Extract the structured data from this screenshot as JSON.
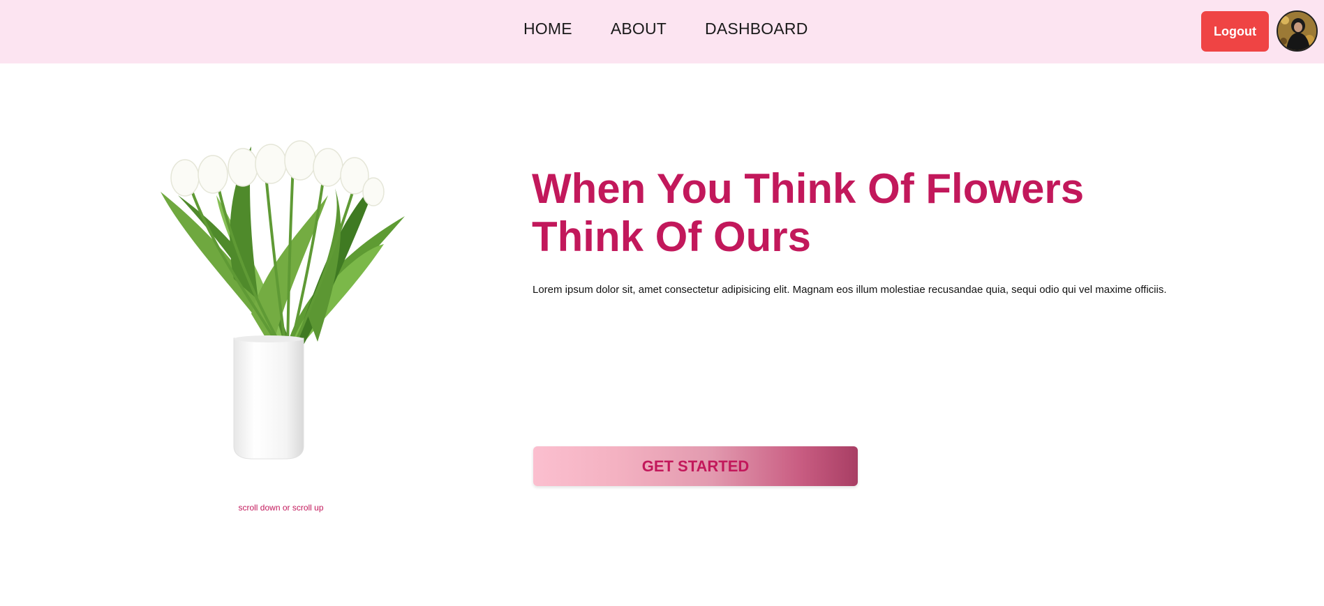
{
  "nav": {
    "links": [
      "HOME",
      "ABOUT",
      "DASHBOARD"
    ],
    "logout_label": "Logout"
  },
  "hero": {
    "title_line1": "When You Think Of Flowers",
    "title_line2": "Think Of Ours",
    "description": "Lorem ipsum dolor sit, amet consectetur adipisicing elit. Magnam eos illum molestiae recusandae quia, sequi odio qui vel maxime officiis.",
    "cta_label": "GET STARTED",
    "scroll_hint": "scroll down or scroll up"
  },
  "colors": {
    "navbar_bg": "#fce4f1",
    "accent": "#c2185b",
    "logout_bg": "#ef4444"
  },
  "icons": {
    "avatar": "user-avatar",
    "hero_image": "white-tulips-in-vase"
  }
}
